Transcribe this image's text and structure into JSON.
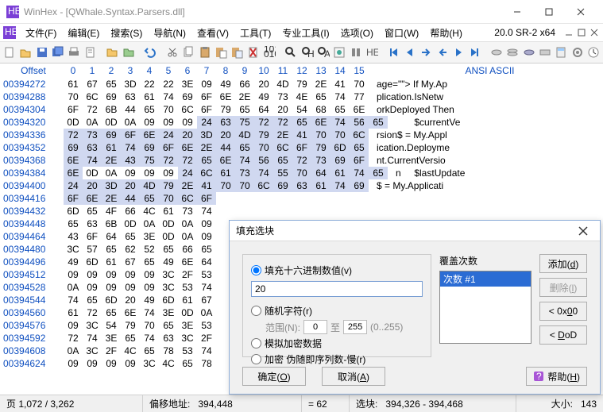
{
  "window": {
    "title": "WinHex - [QWhale.Syntax.Parsers.dll]",
    "version": "20.0 SR-2 x64"
  },
  "menu": {
    "file": "文件(F)",
    "edit": "编辑(E)",
    "search": "搜索(S)",
    "nav": "导航(N)",
    "view": "查看(V)",
    "tools": "工具(T)",
    "protools": "专业工具(I)",
    "options": "选项(O)",
    "window": "窗口(W)",
    "help": "帮助(H)"
  },
  "hexheader": {
    "offset": "Offset",
    "cols": [
      "0",
      "1",
      "2",
      "3",
      "4",
      "5",
      "6",
      "7",
      "8",
      "9",
      "10",
      "11",
      "12",
      "13",
      "14",
      "15"
    ],
    "ascii": "ANSI ASCII"
  },
  "rows": [
    {
      "ofs": "00394272",
      "b": [
        "61",
        "67",
        "65",
        "3D",
        "22",
        "22",
        "3E",
        "09",
        "49",
        "66",
        "20",
        "4D",
        "79",
        "2E",
        "41",
        "70"
      ],
      "asc": "age=\"\"> If My.Ap",
      "sel": []
    },
    {
      "ofs": "00394288",
      "b": [
        "70",
        "6C",
        "69",
        "63",
        "61",
        "74",
        "69",
        "6F",
        "6E",
        "2E",
        "49",
        "73",
        "4E",
        "65",
        "74",
        "77"
      ],
      "asc": "plication.IsNetw",
      "sel": []
    },
    {
      "ofs": "00394304",
      "b": [
        "6F",
        "72",
        "6B",
        "44",
        "65",
        "70",
        "6C",
        "6F",
        "79",
        "65",
        "64",
        "20",
        "54",
        "68",
        "65",
        "6E"
      ],
      "asc": "orkDeployed Then",
      "sel": []
    },
    {
      "ofs": "00394320",
      "b": [
        "0D",
        "0A",
        "0D",
        "0A",
        "09",
        "09",
        "09",
        "24",
        "63",
        "75",
        "72",
        "72",
        "65",
        "6E",
        "74",
        "56",
        "65"
      ],
      "asc": "       $currentVe",
      "sel": [
        7,
        8,
        9,
        10,
        11,
        12,
        13,
        14,
        15,
        16
      ]
    },
    {
      "ofs": "00394336",
      "b": [
        "72",
        "73",
        "69",
        "6F",
        "6E",
        "24",
        "20",
        "3D",
        "20",
        "4D",
        "79",
        "2E",
        "41",
        "70",
        "70",
        "6C"
      ],
      "asc": "rsion$ = My.Appl",
      "sel": [
        0,
        1,
        2,
        3,
        4,
        5,
        6,
        7,
        8,
        9,
        10,
        11,
        12,
        13,
        14,
        15
      ]
    },
    {
      "ofs": "00394352",
      "b": [
        "69",
        "63",
        "61",
        "74",
        "69",
        "6F",
        "6E",
        "2E",
        "44",
        "65",
        "70",
        "6C",
        "6F",
        "79",
        "6D",
        "65"
      ],
      "asc": "ication.Deployme",
      "sel": [
        0,
        1,
        2,
        3,
        4,
        5,
        6,
        7,
        8,
        9,
        10,
        11,
        12,
        13,
        14,
        15
      ]
    },
    {
      "ofs": "00394368",
      "b": [
        "6E",
        "74",
        "2E",
        "43",
        "75",
        "72",
        "72",
        "65",
        "6E",
        "74",
        "56",
        "65",
        "72",
        "73",
        "69",
        "6F"
      ],
      "asc": "nt.CurrentVersio",
      "sel": [
        0,
        1,
        2,
        3,
        4,
        5,
        6,
        7,
        8,
        9,
        10,
        11,
        12,
        13,
        14,
        15
      ]
    },
    {
      "ofs": "00394384",
      "b": [
        "6E",
        "0D",
        "0A",
        "09",
        "09",
        "09",
        "24",
        "6C",
        "61",
        "73",
        "74",
        "55",
        "70",
        "64",
        "61",
        "74",
        "65"
      ],
      "asc": "n     $lastUpdate",
      "sel": [
        0,
        6,
        7,
        8,
        9,
        10,
        11,
        12,
        13,
        14,
        15,
        16
      ]
    },
    {
      "ofs": "00394400",
      "b": [
        "24",
        "20",
        "3D",
        "20",
        "4D",
        "79",
        "2E",
        "41",
        "70",
        "70",
        "6C",
        "69",
        "63",
        "61",
        "74",
        "69"
      ],
      "asc": "$ = My.Applicati",
      "sel": [
        0,
        1,
        2,
        3,
        4,
        5,
        6,
        7,
        8,
        9,
        10,
        11,
        12,
        13,
        14,
        15
      ]
    },
    {
      "ofs": "00394416",
      "b": [
        "6F",
        "6E",
        "2E",
        "44",
        "65",
        "70",
        "6C",
        "6F"
      ],
      "asc": "",
      "sel": [
        0,
        1,
        2,
        3,
        4,
        5,
        6,
        7
      ]
    },
    {
      "ofs": "00394432",
      "b": [
        "6D",
        "65",
        "4F",
        "66",
        "4C",
        "61",
        "73",
        "74"
      ],
      "asc": "",
      "sel": []
    },
    {
      "ofs": "00394448",
      "b": [
        "65",
        "63",
        "6B",
        "0D",
        "0A",
        "0D",
        "0A",
        "09"
      ],
      "asc": "",
      "sel": []
    },
    {
      "ofs": "00394464",
      "b": [
        "43",
        "6F",
        "64",
        "65",
        "3E",
        "0D",
        "0A",
        "09"
      ],
      "asc": "",
      "sel": []
    },
    {
      "ofs": "00394480",
      "b": [
        "3C",
        "57",
        "65",
        "62",
        "52",
        "65",
        "66",
        "65"
      ],
      "asc": "",
      "sel": []
    },
    {
      "ofs": "00394496",
      "b": [
        "49",
        "6D",
        "61",
        "67",
        "65",
        "49",
        "6E",
        "64"
      ],
      "asc": "",
      "sel": []
    },
    {
      "ofs": "00394512",
      "b": [
        "09",
        "09",
        "09",
        "09",
        "09",
        "3C",
        "2F",
        "53"
      ],
      "asc": "",
      "sel": []
    },
    {
      "ofs": "00394528",
      "b": [
        "0A",
        "09",
        "09",
        "09",
        "09",
        "3C",
        "53",
        "74"
      ],
      "asc": "",
      "sel": []
    },
    {
      "ofs": "00394544",
      "b": [
        "74",
        "65",
        "6D",
        "20",
        "49",
        "6D",
        "61",
        "67"
      ],
      "asc": "",
      "sel": []
    },
    {
      "ofs": "00394560",
      "b": [
        "61",
        "72",
        "65",
        "6E",
        "74",
        "3E",
        "0D",
        "0A"
      ],
      "asc": "",
      "sel": []
    },
    {
      "ofs": "00394576",
      "b": [
        "09",
        "3C",
        "54",
        "79",
        "70",
        "65",
        "3E",
        "53"
      ],
      "asc": "",
      "sel": []
    },
    {
      "ofs": "00394592",
      "b": [
        "72",
        "74",
        "3E",
        "65",
        "74",
        "63",
        "3C",
        "2F"
      ],
      "asc": "",
      "sel": []
    },
    {
      "ofs": "00394608",
      "b": [
        "0A",
        "3C",
        "2F",
        "4C",
        "65",
        "78",
        "53",
        "74"
      ],
      "asc": "",
      "sel": []
    },
    {
      "ofs": "00394624",
      "b": [
        "09",
        "09",
        "09",
        "09",
        "3C",
        "4C",
        "65",
        "78"
      ],
      "asc": "",
      "sel": []
    }
  ],
  "status": {
    "page": "页 1,072 / 3,262",
    "offsetlbl": "偏移地址:",
    "offsetval": "394,448",
    "eqlbl": "= 62",
    "sellbl": "选块:",
    "selval": "394,326 - 394,468",
    "sizelbl": "大小:",
    "sizeval": "143"
  },
  "dialog": {
    "title": "填充选块",
    "opt_hex": "填充十六进制数值(v)",
    "hexval": "20",
    "opt_rand": "随机字符(r)",
    "range_lbl": "范围(N):",
    "range_from": "0",
    "range_sep": "至",
    "range_to": "255",
    "range_hint": "(0..255)",
    "opt_sim": "模拟加密数据",
    "opt_enc": "加密 伪随即序列数-慢(r)",
    "passes_lbl": "覆盖次数",
    "passes_item": "次数 #1",
    "btn_add": "添加(d)",
    "btn_del": "删除(l)",
    "btn_0x00": "< 0x00",
    "btn_dod": "< DoD",
    "btn_ok": "确定(O)",
    "btn_cancel": "取消(A)",
    "btn_help": "帮助(H)"
  }
}
